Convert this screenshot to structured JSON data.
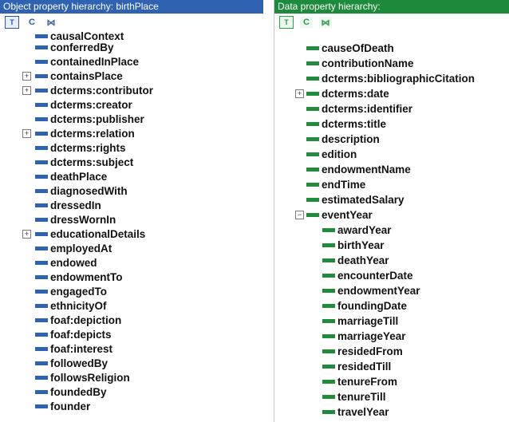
{
  "left_panel": {
    "title": "Object property hierarchy: birthPlace",
    "top_item_partial": "causalContext",
    "items": [
      {
        "label": "conferredBy",
        "expandable": false
      },
      {
        "label": "containedInPlace",
        "expandable": false
      },
      {
        "label": "containsPlace",
        "expandable": true
      },
      {
        "label": "dcterms:contributor",
        "expandable": true
      },
      {
        "label": "dcterms:creator",
        "expandable": false
      },
      {
        "label": "dcterms:publisher",
        "expandable": false
      },
      {
        "label": "dcterms:relation",
        "expandable": true
      },
      {
        "label": "dcterms:rights",
        "expandable": false
      },
      {
        "label": "dcterms:subject",
        "expandable": false
      },
      {
        "label": "deathPlace",
        "expandable": false
      },
      {
        "label": "diagnosedWith",
        "expandable": false
      },
      {
        "label": "dressedIn",
        "expandable": false
      },
      {
        "label": "dressWornIn",
        "expandable": false
      },
      {
        "label": "educationalDetails",
        "expandable": true
      },
      {
        "label": "employedAt",
        "expandable": false
      },
      {
        "label": "endowed",
        "expandable": false
      },
      {
        "label": "endowmentTo",
        "expandable": false
      },
      {
        "label": "engagedTo",
        "expandable": false
      },
      {
        "label": "ethnicityOf",
        "expandable": false
      },
      {
        "label": "foaf:depiction",
        "expandable": false
      },
      {
        "label": "foaf:depicts",
        "expandable": false
      },
      {
        "label": "foaf:interest",
        "expandable": false
      },
      {
        "label": "followedBy",
        "expandable": false
      },
      {
        "label": "followsReligion",
        "expandable": false
      },
      {
        "label": "foundedBy",
        "expandable": false
      },
      {
        "label": "founder",
        "expandable": false
      }
    ]
  },
  "right_panel": {
    "title": "Data property hierarchy:",
    "items": [
      {
        "label": "causeOfDeath",
        "expandable": false,
        "indent": 0
      },
      {
        "label": "contributionName",
        "expandable": false,
        "indent": 0
      },
      {
        "label": "dcterms:bibliographicCitation",
        "expandable": false,
        "indent": 0
      },
      {
        "label": "dcterms:date",
        "expandable": true,
        "indent": 0
      },
      {
        "label": "dcterms:identifier",
        "expandable": false,
        "indent": 0
      },
      {
        "label": "dcterms:title",
        "expandable": false,
        "indent": 0
      },
      {
        "label": "description",
        "expandable": false,
        "indent": 0
      },
      {
        "label": "edition",
        "expandable": false,
        "indent": 0
      },
      {
        "label": "endowmentName",
        "expandable": false,
        "indent": 0
      },
      {
        "label": "endTime",
        "expandable": false,
        "indent": 0
      },
      {
        "label": "estimatedSalary",
        "expandable": false,
        "indent": 0
      },
      {
        "label": "eventYear",
        "expandable": true,
        "expanded": true,
        "indent": 0
      },
      {
        "label": "awardYear",
        "expandable": false,
        "indent": 1
      },
      {
        "label": "birthYear",
        "expandable": false,
        "indent": 1
      },
      {
        "label": "deathYear",
        "expandable": false,
        "indent": 1
      },
      {
        "label": "encounterDate",
        "expandable": false,
        "indent": 1
      },
      {
        "label": "endowmentYear",
        "expandable": false,
        "indent": 1
      },
      {
        "label": "foundingDate",
        "expandable": false,
        "indent": 1
      },
      {
        "label": "marriageTill",
        "expandable": false,
        "indent": 1
      },
      {
        "label": "marriageYear",
        "expandable": false,
        "indent": 1
      },
      {
        "label": "residedFrom",
        "expandable": false,
        "indent": 1
      },
      {
        "label": "residedTill",
        "expandable": false,
        "indent": 1
      },
      {
        "label": "tenureFrom",
        "expandable": false,
        "indent": 1
      },
      {
        "label": "tenureTill",
        "expandable": false,
        "indent": 1
      },
      {
        "label": "travelYear",
        "expandable": false,
        "indent": 1
      }
    ]
  },
  "toolbar": {
    "add_sub_glyph": "T",
    "add_sibling_glyph": "C",
    "delete_glyph": "⋈",
    "expand_glyph": "+",
    "collapse_glyph": "−"
  },
  "colors": {
    "object_accent": "#2f62b0",
    "data_accent": "#1f8b3b"
  }
}
